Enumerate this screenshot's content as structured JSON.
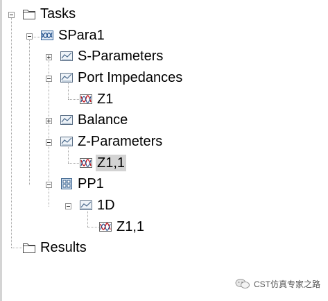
{
  "tree": {
    "tasks": "Tasks",
    "spara1": "SPara1",
    "s_parameters": "S-Parameters",
    "port_impedances": "Port Impedances",
    "z1": "Z1",
    "balance": "Balance",
    "z_parameters": "Z-Parameters",
    "z11_a": "Z1,1",
    "pp1": "PP1",
    "oneD": "1D",
    "z11_b": "Z1,1",
    "results": "Results"
  },
  "watermark": "CST仿真专家之路"
}
